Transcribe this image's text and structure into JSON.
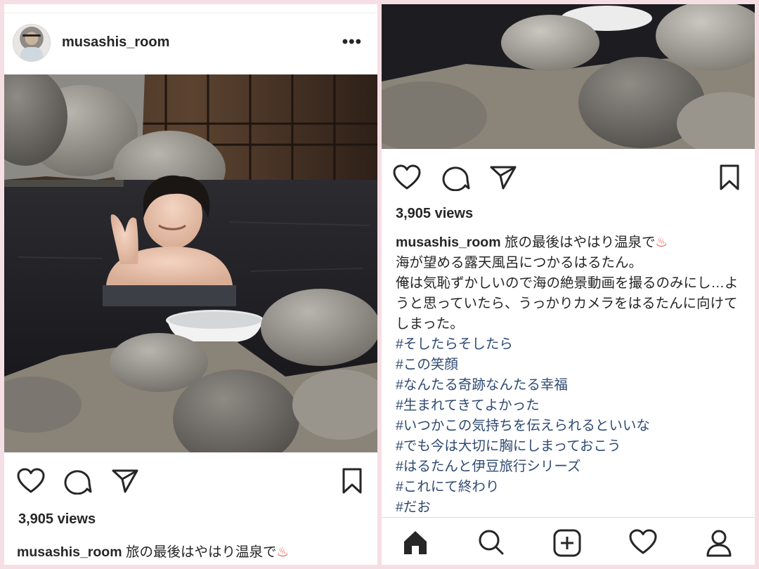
{
  "post": {
    "username": "musashis_room",
    "more_icon": "•••",
    "views": "3,905 views",
    "caption_first_line": "旅の最後はやはり温泉で",
    "hot_spring_emoji": "♨",
    "caption_lines": [
      "海が望める露天風呂につかるはるたん。",
      "俺は気恥ずかしいので海の絶景動画を撮るのみにし…ようと思っていたら、うっかりカメラをはるたんに向けてしまった。"
    ],
    "hashtags": [
      "#そしたらそしたら",
      "#この笑顔",
      "#なんたる奇跡なんたる幸福",
      "#生まれてきてよかった",
      "#いつかこの気持ちを伝えられるといいな",
      "#でも今は大切に胸にしまっておこう",
      "#はるたんと伊豆旅行シリーズ",
      "#これにて終わり",
      "#だお"
    ]
  },
  "icons": {
    "like": "heart-icon",
    "comment": "comment-icon",
    "share": "paper-plane-icon",
    "save": "bookmark-icon",
    "nav": [
      "home-icon",
      "search-icon",
      "new-post-icon",
      "activity-heart-icon",
      "profile-icon"
    ]
  },
  "colors": {
    "background": "#f6dfe4",
    "hashtag": "#2f4a72",
    "text": "#262626"
  }
}
